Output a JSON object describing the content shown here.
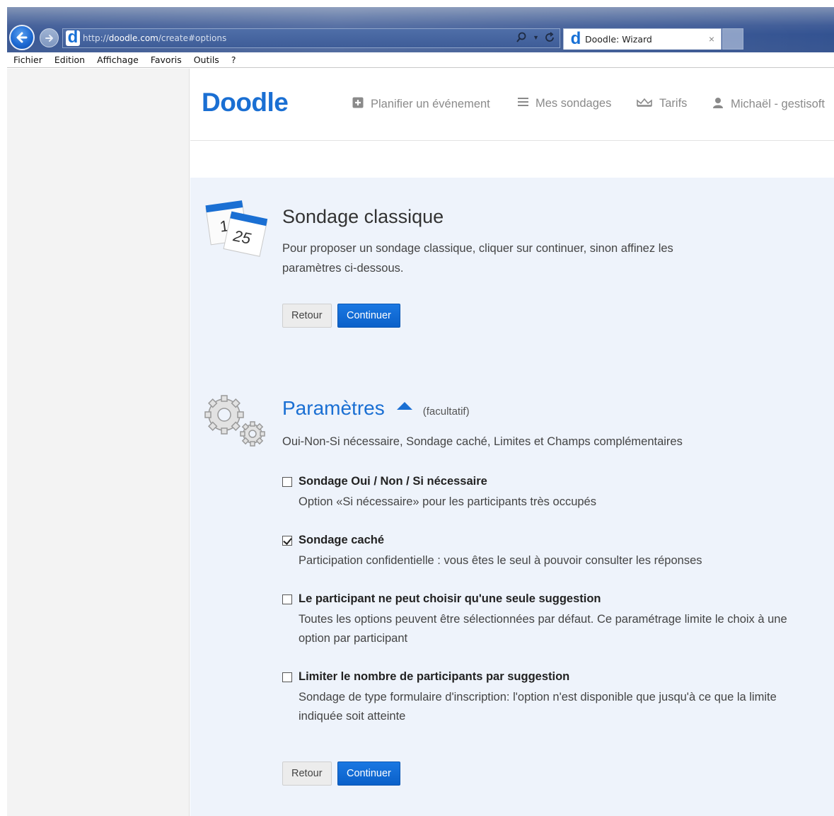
{
  "browser": {
    "url_prefix": "http://",
    "url_domain": "doodle.com",
    "url_path": "/create#options",
    "tab_title": "Doodle: Wizard",
    "tab_close": "×",
    "menu": [
      "Fichier",
      "Edition",
      "Affichage",
      "Favoris",
      "Outils",
      "?"
    ]
  },
  "header": {
    "logo": "Doodle",
    "nav": {
      "plan": "Planifier un événement",
      "polls": "Mes sondages",
      "pricing": "Tarifs",
      "user": "Michaël - gestisoft"
    }
  },
  "classic": {
    "title": "Sondage classique",
    "text": "Pour proposer un sondage classique, cliquer sur continuer, sinon affinez les paramètres ci-dessous.",
    "back_label": "Retour",
    "continue_label": "Continuer",
    "calendar_top": "1",
    "calendar_bottom": "25"
  },
  "settings": {
    "title": "Paramètres",
    "optional": "(facultatif)",
    "subtitle": "Oui-Non-Si nécessaire, Sondage caché, Limites et Champs complémentaires",
    "options": [
      {
        "label": "Sondage Oui / Non / Si nécessaire",
        "desc": "Option «Si nécessaire» pour les participants très occupés",
        "checked": false
      },
      {
        "label": "Sondage caché",
        "desc": "Participation confidentielle : vous êtes le seul à pouvoir consulter les réponses",
        "checked": true
      },
      {
        "label": "Le participant ne peut choisir qu'une seule suggestion",
        "desc": "Toutes les options peuvent être sélectionnées par défaut. Ce paramétrage limite le choix à une option par participant",
        "checked": false
      },
      {
        "label": "Limiter le nombre de participants par suggestion",
        "desc": "Sondage de type formulaire d'inscription: l'option n'est disponible que jusqu'à ce que la limite indiquée soit atteinte",
        "checked": false
      }
    ],
    "back_label": "Retour",
    "continue_label": "Continuer"
  },
  "colors": {
    "brand": "#1a6fd3",
    "content_bg": "#eef3fb"
  },
  "icons": [
    "back-arrow-icon",
    "forward-arrow-icon",
    "search-icon",
    "refresh-icon",
    "plus-square-icon",
    "list-icon",
    "crown-icon",
    "user-icon",
    "calendar-icon",
    "gears-icon"
  ]
}
